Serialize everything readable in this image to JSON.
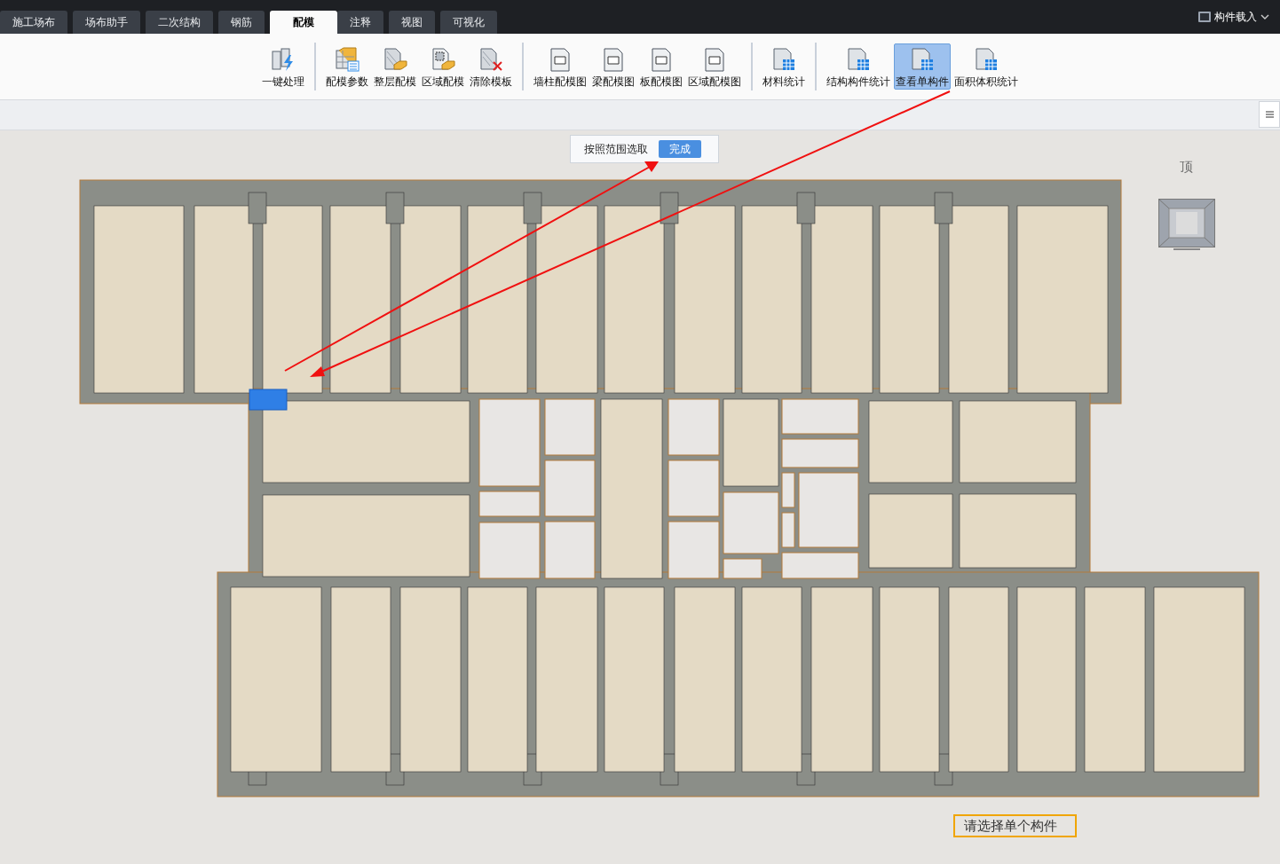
{
  "tabs": [
    {
      "label": "施工场布",
      "selected": false
    },
    {
      "label": "场布助手",
      "selected": false
    },
    {
      "label": "二次结构",
      "selected": false
    },
    {
      "label": "钢筋",
      "selected": false
    },
    {
      "label": "配模",
      "selected": true
    },
    {
      "label": "注释",
      "selected": false
    },
    {
      "label": "视图",
      "selected": false
    },
    {
      "label": "可视化",
      "selected": false
    }
  ],
  "load_button": {
    "label": "构件载入"
  },
  "ribbon": {
    "groups": [
      [
        {
          "label": "一键处理",
          "kind": "bolt",
          "selected": false
        }
      ],
      [
        {
          "label": "配模参数",
          "kind": "table",
          "selected": false
        },
        {
          "label": "整层配模",
          "kind": "layer",
          "selected": false
        },
        {
          "label": "区域配模",
          "kind": "region",
          "selected": false
        },
        {
          "label": "清除模板",
          "kind": "clear",
          "selected": false
        }
      ],
      [
        {
          "label": "墙柱配模图",
          "kind": "doc",
          "selected": false
        },
        {
          "label": "梁配模图",
          "kind": "doc",
          "selected": false
        },
        {
          "label": "板配模图",
          "kind": "doc",
          "selected": false
        },
        {
          "label": "区域配模图",
          "kind": "doc",
          "selected": false
        }
      ],
      [
        {
          "label": "材料统计",
          "kind": "grid",
          "selected": false
        }
      ],
      [
        {
          "label": "结构构件统计",
          "kind": "grid",
          "selected": false
        },
        {
          "label": "查看单构件",
          "kind": "grid",
          "selected": true
        },
        {
          "label": "面积体积统计",
          "kind": "grid",
          "selected": false
        }
      ]
    ]
  },
  "canvas": {
    "selection_popup": {
      "label": "按照范围选取",
      "button": "完成"
    },
    "view_cube_label": "顶",
    "prompt": "请选择单个构件"
  }
}
